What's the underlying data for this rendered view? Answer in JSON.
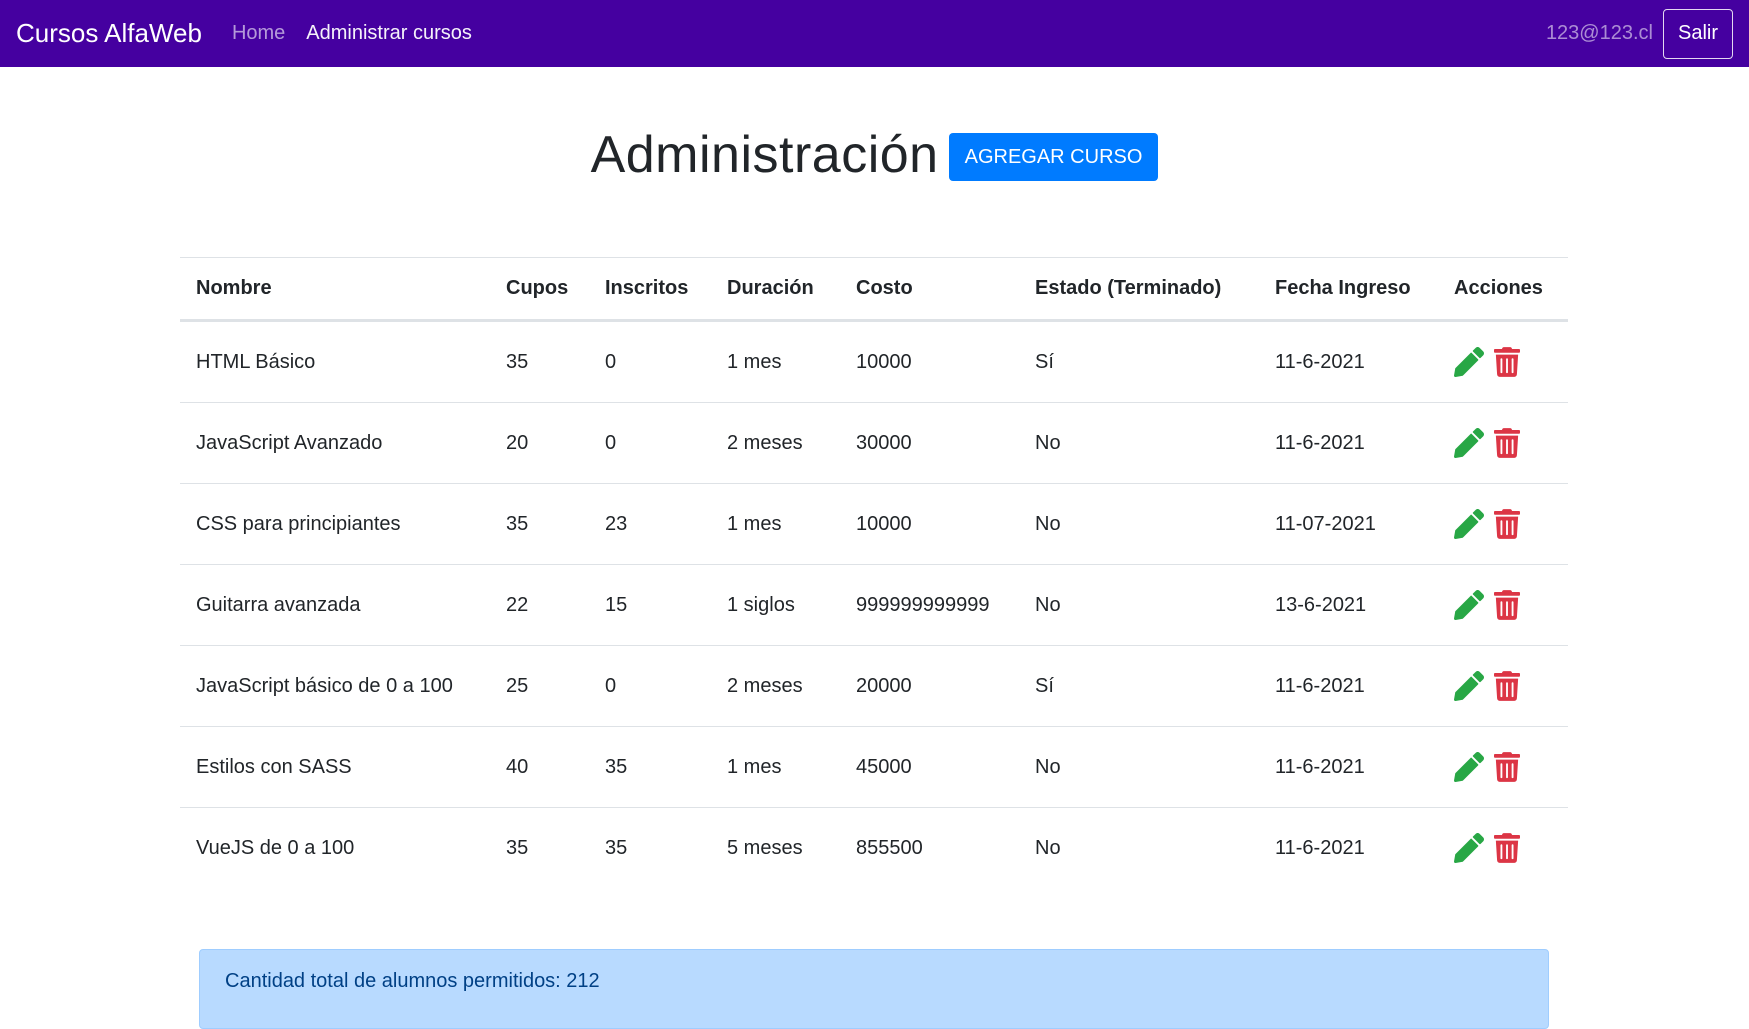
{
  "navbar": {
    "brand": "Cursos AlfaWeb",
    "links": [
      {
        "label": "Home"
      },
      {
        "label": "Administrar cursos"
      }
    ],
    "user_email": "123@123.cl",
    "logout_label": "Salir"
  },
  "header": {
    "title": "Administración",
    "add_button_label": "AGREGAR CURSO"
  },
  "table": {
    "headers": {
      "nombre": "Nombre",
      "cupos": "Cupos",
      "inscritos": "Inscritos",
      "duracion": "Duración",
      "costo": "Costo",
      "estado": "Estado (Terminado)",
      "fecha": "Fecha Ingreso",
      "acciones": "Acciones"
    },
    "rows": [
      {
        "nombre": "HTML Básico",
        "cupos": "35",
        "inscritos": "0",
        "duracion": "1 mes",
        "costo": "10000",
        "estado": "Sí",
        "fecha": "11-6-2021"
      },
      {
        "nombre": "JavaScript Avanzado",
        "cupos": "20",
        "inscritos": "0",
        "duracion": "2 meses",
        "costo": "30000",
        "estado": "No",
        "fecha": "11-6-2021"
      },
      {
        "nombre": "CSS para principiantes",
        "cupos": "35",
        "inscritos": "23",
        "duracion": "1 mes",
        "costo": "10000",
        "estado": "No",
        "fecha": "11-07-2021"
      },
      {
        "nombre": "Guitarra avanzada",
        "cupos": "22",
        "inscritos": "15",
        "duracion": "1 siglos",
        "costo": "999999999999",
        "estado": "No",
        "fecha": "13-6-2021"
      },
      {
        "nombre": "JavaScript básico de 0 a 100",
        "cupos": "25",
        "inscritos": "0",
        "duracion": "2 meses",
        "costo": "20000",
        "estado": "Sí",
        "fecha": "11-6-2021"
      },
      {
        "nombre": "Estilos con SASS",
        "cupos": "40",
        "inscritos": "35",
        "duracion": "1 mes",
        "costo": "45000",
        "estado": "No",
        "fecha": "11-6-2021"
      },
      {
        "nombre": "VueJS de 0 a 100",
        "cupos": "35",
        "inscritos": "35",
        "duracion": "5 meses",
        "costo": "855500",
        "estado": "No",
        "fecha": "11-6-2021"
      }
    ],
    "action_icons": {
      "edit": "pencil-icon",
      "delete": "trash-icon"
    }
  },
  "info": {
    "text": "Cantidad total de alumnos permitidos: 212"
  },
  "colors": {
    "navbar_bg": "#4500a0",
    "primary": "#007bff",
    "edit": "#28a745",
    "delete": "#dc3545",
    "info_bg": "#b8daff"
  }
}
